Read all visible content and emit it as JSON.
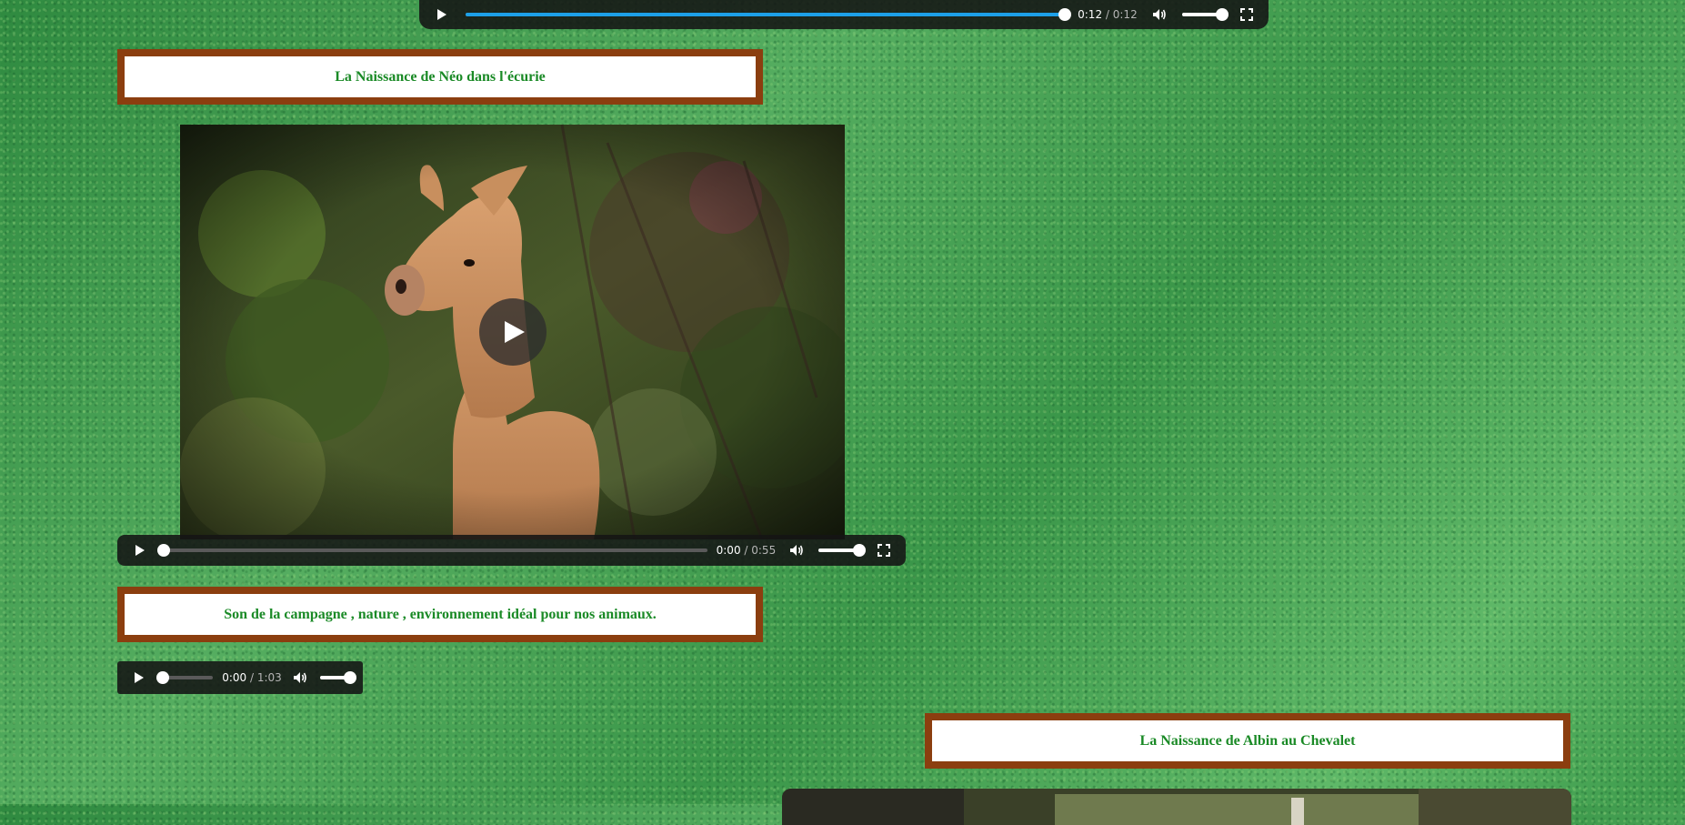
{
  "top_player": {
    "current_time": "0:12",
    "separator": " / ",
    "duration": "0:12",
    "progress": 1.0,
    "volume": 1.0,
    "progress_color": "#1da0e8"
  },
  "section_neo": {
    "title": "La Naissance de Néo dans l'écurie",
    "video": {
      "current_time": "0:00",
      "separator": " / ",
      "duration": "0:55",
      "progress": 0.0,
      "volume": 1.0
    }
  },
  "section_sound": {
    "title": "Son de la campagne , nature , environnement idéal pour nos animaux.",
    "audio": {
      "current_time": "0:00",
      "separator": " / ",
      "duration": "1:03",
      "progress": 0.0,
      "volume": 1.0
    }
  },
  "section_albin": {
    "title": "La Naissance de Albin au Chevalet"
  },
  "colors": {
    "title_border": "#8b3e0f",
    "title_text": "#1a8a26",
    "background": "#3f9a4c"
  }
}
